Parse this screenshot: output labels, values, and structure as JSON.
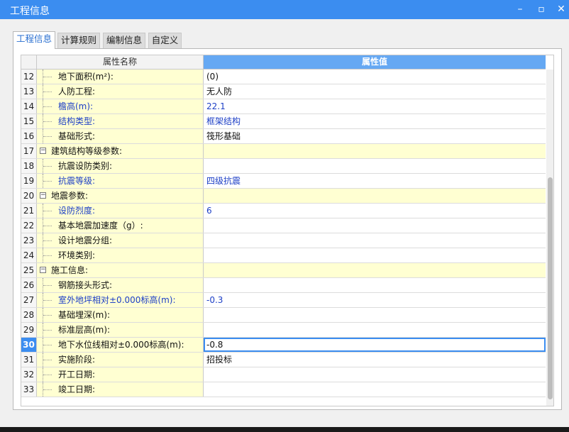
{
  "window": {
    "title": "工程信息",
    "controls": {
      "minimize": "–",
      "maximize": "▫",
      "close": "✕"
    }
  },
  "tabs": [
    {
      "label": "工程信息",
      "active": true
    },
    {
      "label": "计算规则",
      "active": false
    },
    {
      "label": "编制信息",
      "active": false
    },
    {
      "label": "自定义",
      "active": false
    }
  ],
  "grid": {
    "columns": {
      "name": "属性名称",
      "value": "属性值"
    },
    "rows": [
      {
        "num": "12",
        "name": "地下面积(m²):",
        "value": "(0)"
      },
      {
        "num": "13",
        "name": "人防工程:",
        "value": "无人防"
      },
      {
        "num": "14",
        "name": "檐高(m):",
        "value": "22.1"
      },
      {
        "num": "15",
        "name": "结构类型:",
        "value": "框架结构"
      },
      {
        "num": "16",
        "name": "基础形式:",
        "value": "筏形基础"
      },
      {
        "num": "17",
        "name": "建筑结构等级参数:",
        "value": ""
      },
      {
        "num": "18",
        "name": "抗震设防类别:",
        "value": ""
      },
      {
        "num": "19",
        "name": "抗震等级:",
        "value": "四级抗震"
      },
      {
        "num": "20",
        "name": "地震参数:",
        "value": ""
      },
      {
        "num": "21",
        "name": "设防烈度:",
        "value": "6"
      },
      {
        "num": "22",
        "name": "基本地震加速度（g）:",
        "value": ""
      },
      {
        "num": "23",
        "name": "设计地震分组:",
        "value": ""
      },
      {
        "num": "24",
        "name": "环境类别:",
        "value": ""
      },
      {
        "num": "25",
        "name": "施工信息:",
        "value": ""
      },
      {
        "num": "26",
        "name": "钢筋接头形式:",
        "value": ""
      },
      {
        "num": "27",
        "name": "室外地坪相对±0.000标高(m):",
        "value": "-0.3"
      },
      {
        "num": "28",
        "name": "基础埋深(m):",
        "value": ""
      },
      {
        "num": "29",
        "name": "标准层高(m):",
        "value": ""
      },
      {
        "num": "30",
        "name": "地下水位线相对±0.000标高(m):",
        "value": "-0.8"
      },
      {
        "num": "31",
        "name": "实施阶段:",
        "value": "招投标"
      },
      {
        "num": "32",
        "name": "开工日期:",
        "value": ""
      },
      {
        "num": "33",
        "name": "竣工日期:",
        "value": ""
      }
    ],
    "group_expander": "−"
  },
  "colors": {
    "accent": "#3b8df0",
    "header_value_bg": "#65a8f3",
    "name_cell_bg": "#ffffd2",
    "blue_text": "#1d3fc6"
  }
}
